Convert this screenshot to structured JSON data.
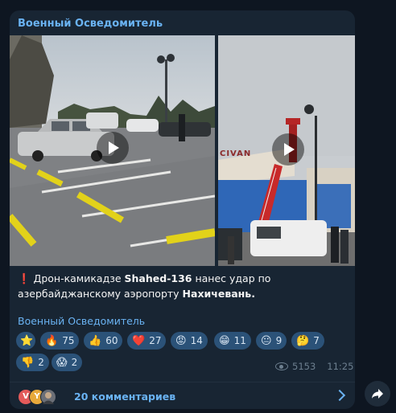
{
  "post": {
    "channel": "Военный Осведомитель",
    "text_prefix_icon": "❗️",
    "text_1": "Дрон-камикадзе ",
    "text_bold_1": "Shahed-136",
    "text_2": " нанес удар по азербайджанскому аэропорту ",
    "text_bold_2": "Нахичевань.",
    "signature": "Военный Осведомитель",
    "views": "5153",
    "time": "11:25",
    "comments_label": "20 комментариев",
    "sign_text": "CIVAN"
  },
  "reactions": [
    {
      "emoji": "⭐",
      "count": ""
    },
    {
      "emoji": "🔥",
      "count": "75"
    },
    {
      "emoji": "👍",
      "count": "60"
    },
    {
      "emoji": "❤️",
      "count": "27"
    },
    {
      "emoji": "😡",
      "count": "14"
    },
    {
      "emoji": "😁",
      "count": "11"
    },
    {
      "emoji": "😐",
      "count": "9"
    },
    {
      "emoji": "🤔",
      "count": "7"
    },
    {
      "emoji": "👎",
      "count": "2"
    },
    {
      "emoji": "😱",
      "count": "2"
    }
  ],
  "commenters": [
    {
      "initial": "V",
      "color": "#e35a5a"
    },
    {
      "initial": "Y",
      "color": "#e8a93b"
    },
    {
      "initial": "",
      "color": "#6b6f77"
    }
  ],
  "icons": {
    "play": "play-icon",
    "eye": "eye-icon",
    "chevron": "chevron-right-icon",
    "share": "share-icon"
  }
}
